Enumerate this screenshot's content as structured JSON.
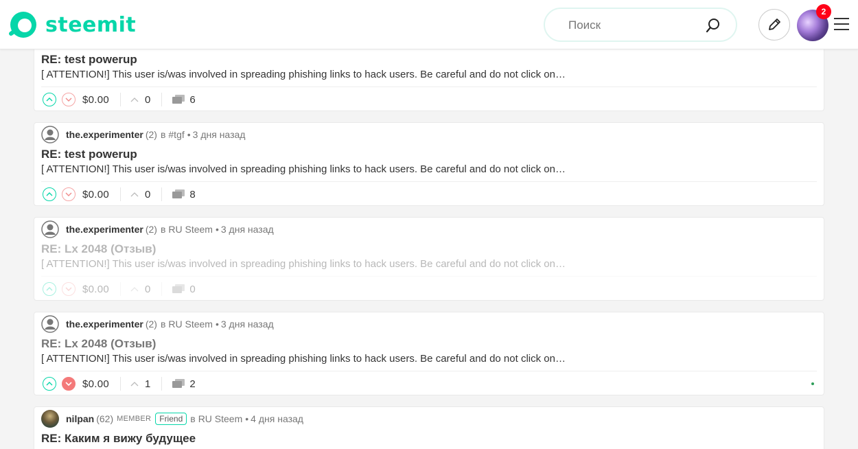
{
  "header": {
    "logo_text": "steemit",
    "search_placeholder": "Поиск",
    "notification_count": "2",
    "brand_color": "#06d6a9"
  },
  "posts": [
    {
      "title": "RE: test powerup",
      "excerpt": "[ ATTENTION!] This user is/was involved in spreading phishing links to hack users. Be careful and do not click on…",
      "payout": "$0.00",
      "votes": "0",
      "comments": "6"
    },
    {
      "author": "the.experimenter",
      "reputation": "(2)",
      "in_word": "в",
      "community": "#tgf",
      "time": "3 дня назад",
      "title": "RE: test powerup",
      "excerpt": "[ ATTENTION!] This user is/was involved in spreading phishing links to hack users. Be careful and do not click on…",
      "payout": "$0.00",
      "votes": "0",
      "comments": "8"
    },
    {
      "author": "the.experimenter",
      "reputation": "(2)",
      "in_word": "в",
      "community": "RU Steem",
      "time": "3 дня назад",
      "title": "RE: Lx 2048 (Отзыв)",
      "excerpt": "[ ATTENTION!] This user is/was involved in spreading phishing links to hack users. Be careful and do not click on…",
      "payout": "$0.00",
      "votes": "0",
      "comments": "0"
    },
    {
      "author": "the.experimenter",
      "reputation": "(2)",
      "in_word": "в",
      "community": "RU Steem",
      "time": "3 дня назад",
      "title": "RE: Lx 2048 (Отзыв)",
      "excerpt": "[ ATTENTION!] This user is/was involved in spreading phishing links to hack users. Be careful and do not click on…",
      "payout": "$0.00",
      "votes": "1",
      "comments": "2"
    },
    {
      "author": "nilpan",
      "reputation": "(62)",
      "role": "MEMBER",
      "label": "Friend",
      "in_word": "в",
      "community": "RU Steem",
      "time": "4 дня назад",
      "title": "RE: Каким я вижу будущее"
    }
  ]
}
